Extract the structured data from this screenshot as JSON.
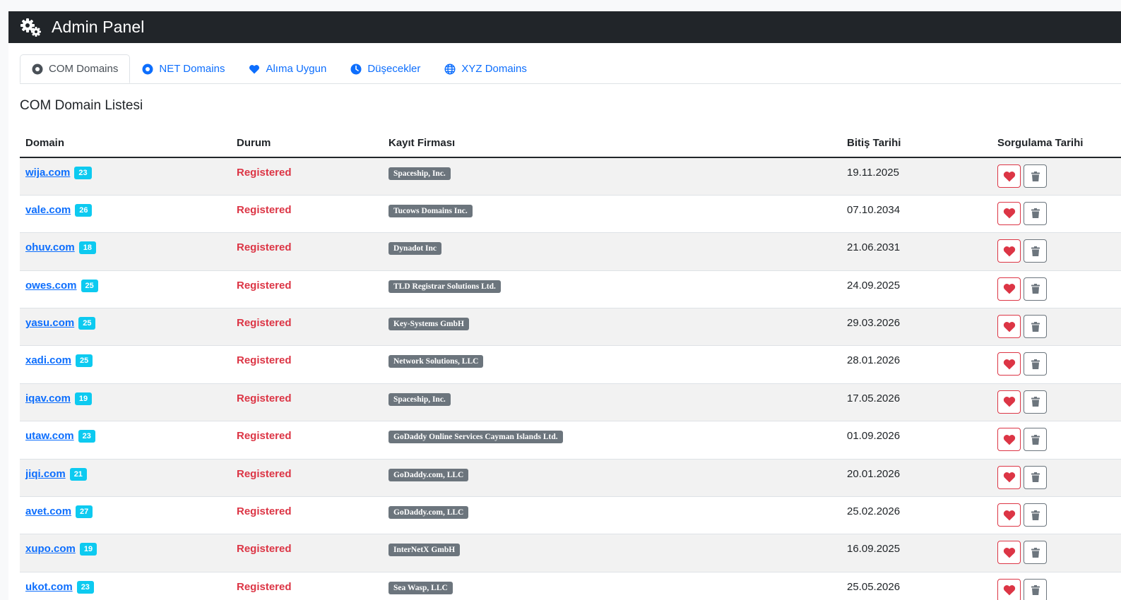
{
  "header": {
    "title": "Admin Panel",
    "icon": "gears-icon"
  },
  "tabs": [
    {
      "label": "COM Domains",
      "icon": "circle-dot-icon",
      "active": true
    },
    {
      "label": "NET Domains",
      "icon": "circle-dot-icon",
      "active": false
    },
    {
      "label": "Alıma Uygun",
      "icon": "heart-icon",
      "active": false
    },
    {
      "label": "Düşecekler",
      "icon": "clock-icon",
      "active": false
    },
    {
      "label": "XYZ Domains",
      "icon": "globe-icon",
      "active": false
    }
  ],
  "section": {
    "title": "COM Domain Listesi"
  },
  "table": {
    "columns": {
      "domain": "Domain",
      "status": "Durum",
      "registrar": "Kayıt Firması",
      "expiry": "Bitiş Tarihi",
      "queried": "Sorgulama Tarihi"
    },
    "rows": [
      {
        "domain": "wija.com",
        "count": "23",
        "status": "Registered",
        "registrar": "Spaceship, Inc.",
        "expiry": "19.11.2025"
      },
      {
        "domain": "vale.com",
        "count": "26",
        "status": "Registered",
        "registrar": "Tucows Domains Inc.",
        "expiry": "07.10.2034"
      },
      {
        "domain": "ohuv.com",
        "count": "18",
        "status": "Registered",
        "registrar": "Dynadot Inc",
        "expiry": "21.06.2031"
      },
      {
        "domain": "owes.com",
        "count": "25",
        "status": "Registered",
        "registrar": "TLD Registrar Solutions Ltd.",
        "expiry": "24.09.2025"
      },
      {
        "domain": "yasu.com",
        "count": "25",
        "status": "Registered",
        "registrar": "Key-Systems GmbH",
        "expiry": "29.03.2026"
      },
      {
        "domain": "xadi.com",
        "count": "25",
        "status": "Registered",
        "registrar": "Network Solutions, LLC",
        "expiry": "28.01.2026"
      },
      {
        "domain": "iqav.com",
        "count": "19",
        "status": "Registered",
        "registrar": "Spaceship, Inc.",
        "expiry": "17.05.2026"
      },
      {
        "domain": "utaw.com",
        "count": "23",
        "status": "Registered",
        "registrar": "GoDaddy Online Services Cayman Islands Ltd.",
        "expiry": "01.09.2026"
      },
      {
        "domain": "jiqi.com",
        "count": "21",
        "status": "Registered",
        "registrar": "GoDaddy.com, LLC",
        "expiry": "20.01.2026"
      },
      {
        "domain": "avet.com",
        "count": "27",
        "status": "Registered",
        "registrar": "GoDaddy.com, LLC",
        "expiry": "25.02.2026"
      },
      {
        "domain": "xupo.com",
        "count": "19",
        "status": "Registered",
        "registrar": "InterNetX GmbH",
        "expiry": "16.09.2025"
      },
      {
        "domain": "ukot.com",
        "count": "23",
        "status": "Registered",
        "registrar": "Sea Wasp, LLC",
        "expiry": "25.05.2026"
      }
    ]
  },
  "colors": {
    "navbar": "#212529",
    "link": "#0d6efd",
    "status": "#dc3545",
    "count_badge": "#0dcaf0",
    "registrar_badge": "#6c757d"
  }
}
